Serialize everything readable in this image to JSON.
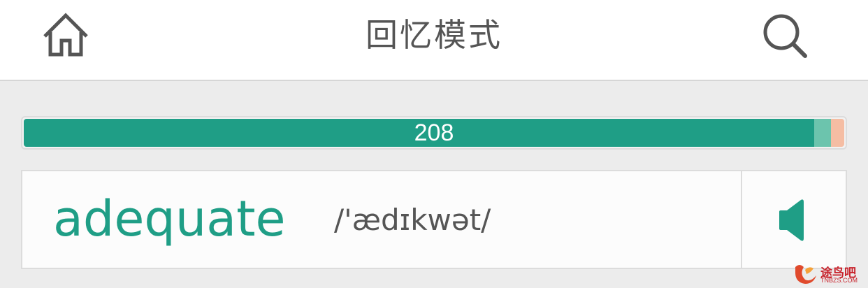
{
  "header": {
    "title": "回忆模式",
    "home_icon": "home-icon",
    "search_icon": "search-icon"
  },
  "progress": {
    "count": "208",
    "segments": [
      {
        "name": "main",
        "fraction": 0.963,
        "color": "#1f9e86"
      },
      {
        "name": "light",
        "fraction": 0.021,
        "color": "#6cc4ad"
      },
      {
        "name": "orange",
        "fraction": 0.016,
        "color": "#f5bda3"
      }
    ]
  },
  "card": {
    "word": "adequate",
    "phonetic": "/'ædɪkwət/",
    "speaker_icon": "speaker-icon"
  },
  "watermark": {
    "text": "途鸟吧",
    "sub": "TNBZS.COM"
  },
  "colors": {
    "accent": "#1f9e86",
    "text": "#555555",
    "background": "#ececec"
  }
}
